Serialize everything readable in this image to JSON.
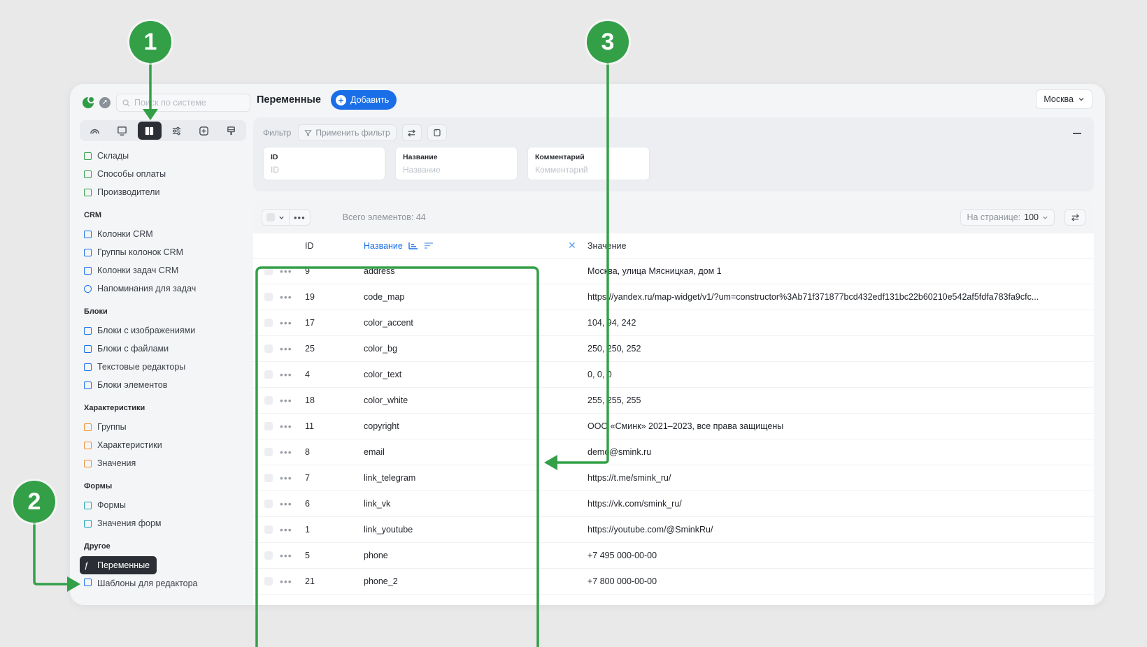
{
  "sidebar": {
    "search_placeholder": "Поиск по системе",
    "mode_icons": [
      "dashboard-icon",
      "monitor-icon",
      "book-icon",
      "sliders-icon",
      "plus-square-icon",
      "brush-icon"
    ],
    "items_top": [
      {
        "label": "Склады",
        "color": "#2f9c46"
      },
      {
        "label": "Способы оплаты",
        "color": "#2f9c46"
      },
      {
        "label": "Производители",
        "color": "#2f9c46"
      }
    ],
    "groups": [
      {
        "title": "CRM",
        "items": [
          {
            "label": "Колонки CRM",
            "color": "#1a6fe8"
          },
          {
            "label": "Группы колонок CRM",
            "color": "#1a6fe8"
          },
          {
            "label": "Колонки задач CRM",
            "color": "#1a6fe8"
          },
          {
            "label": "Напоминания для задач",
            "color": "#1a6fe8"
          }
        ]
      },
      {
        "title": "Блоки",
        "items": [
          {
            "label": "Блоки с изображениями",
            "color": "#1a6fe8"
          },
          {
            "label": "Блоки с файлами",
            "color": "#1a6fe8"
          },
          {
            "label": "Текстовые редакторы",
            "color": "#1a6fe8"
          },
          {
            "label": "Блоки элементов",
            "color": "#1a6fe8"
          }
        ]
      },
      {
        "title": "Характеристики",
        "items": [
          {
            "label": "Группы",
            "color": "#f08c2a"
          },
          {
            "label": "Характеристики",
            "color": "#f08c2a"
          },
          {
            "label": "Значения",
            "color": "#f08c2a"
          }
        ]
      },
      {
        "title": "Формы",
        "items": [
          {
            "label": "Формы",
            "color": "#16a3b8"
          },
          {
            "label": "Значения форм",
            "color": "#16a3b8"
          }
        ]
      },
      {
        "title": "Другое",
        "items": [
          {
            "label": "Переменные",
            "color": "#ffffff",
            "active": true
          },
          {
            "label": "Шаблоны для редактора",
            "color": "#1a6fe8",
            "cut": true
          }
        ]
      }
    ]
  },
  "header": {
    "title": "Переменные",
    "add_label": "Добавить",
    "city": "Москва"
  },
  "filter": {
    "label": "Фильтр",
    "apply_label": "Применить фильтр",
    "fields": [
      {
        "label": "ID",
        "placeholder": "ID"
      },
      {
        "label": "Название",
        "placeholder": "Название"
      },
      {
        "label": "Комментарий",
        "placeholder": "Комментарий"
      }
    ]
  },
  "table": {
    "total": "Всего элементов: 44",
    "per_page_label": "На странице:",
    "per_page_value": "100",
    "columns": {
      "id": "ID",
      "name": "Название",
      "value": "Значение"
    },
    "rows": [
      {
        "id": "9",
        "name": "address",
        "value": "Москва, улица Мясницкая, дом 1"
      },
      {
        "id": "19",
        "name": "code_map",
        "value": "https://yandex.ru/map-widget/v1/?um=constructor%3Ab71f371877bcd432edf131bc22b60210e542af5fdfa783fa9cfc..."
      },
      {
        "id": "17",
        "name": "color_accent",
        "value": "104, 94, 242"
      },
      {
        "id": "25",
        "name": "color_bg",
        "value": "250, 250, 252"
      },
      {
        "id": "4",
        "name": "color_text",
        "value": "0, 0, 0"
      },
      {
        "id": "18",
        "name": "color_white",
        "value": "255, 255, 255"
      },
      {
        "id": "11",
        "name": "copyright",
        "value": "ООО «Сминк» 2021–2023, все права защищены"
      },
      {
        "id": "8",
        "name": "email",
        "value": "demo@smink.ru"
      },
      {
        "id": "7",
        "name": "link_telegram",
        "value": "https://t.me/smink_ru/"
      },
      {
        "id": "6",
        "name": "link_vk",
        "value": "https://vk.com/smink_ru/"
      },
      {
        "id": "1",
        "name": "link_youtube",
        "value": "https://youtube.com/@SminkRu/"
      },
      {
        "id": "5",
        "name": "phone",
        "value": "+7 495 000-00-00"
      },
      {
        "id": "21",
        "name": "phone_2",
        "value": "+7 800 000-00-00"
      }
    ]
  },
  "annotations": {
    "badges": [
      "1",
      "2",
      "3"
    ],
    "color": "#33a048"
  }
}
